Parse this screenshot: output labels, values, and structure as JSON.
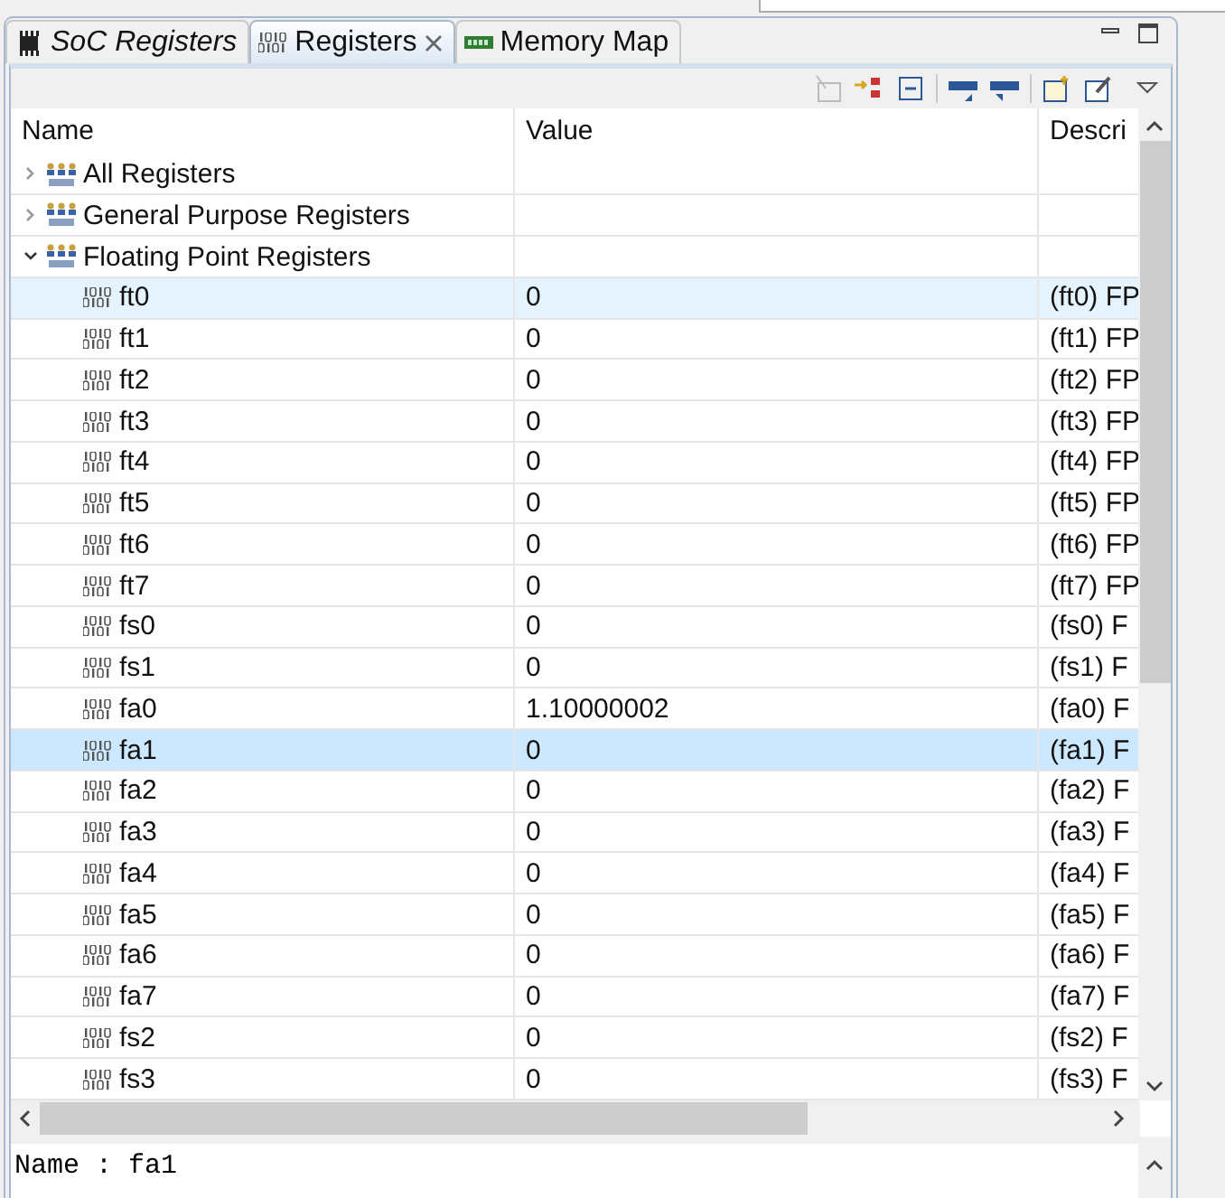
{
  "tabs": [
    {
      "label": "SoC Registers",
      "kind": "chip",
      "selected": false,
      "italic": true,
      "closable": false
    },
    {
      "label": "Registers",
      "kind": "binary",
      "selected": true,
      "italic": false,
      "closable": true
    },
    {
      "label": "Memory Map",
      "kind": "memory",
      "selected": false,
      "italic": false,
      "closable": false
    }
  ],
  "table": {
    "columns": [
      "Name",
      "Value",
      "Descri"
    ],
    "rows": [
      {
        "kind": "group",
        "name": "All Registers",
        "expanded": false,
        "selected": false,
        "hovered": false
      },
      {
        "kind": "group",
        "name": "General Purpose Registers",
        "expanded": false,
        "selected": false,
        "hovered": false
      },
      {
        "kind": "group",
        "name": "Floating Point Registers",
        "expanded": true,
        "selected": false,
        "hovered": false
      },
      {
        "kind": "register",
        "name": "ft0",
        "value": "0",
        "description": "(ft0) FP",
        "selected": false,
        "hovered": true
      },
      {
        "kind": "register",
        "name": "ft1",
        "value": "0",
        "description": "(ft1) FP",
        "selected": false,
        "hovered": false
      },
      {
        "kind": "register",
        "name": "ft2",
        "value": "0",
        "description": "(ft2) FP",
        "selected": false,
        "hovered": false
      },
      {
        "kind": "register",
        "name": "ft3",
        "value": "0",
        "description": "(ft3) FP",
        "selected": false,
        "hovered": false
      },
      {
        "kind": "register",
        "name": "ft4",
        "value": "0",
        "description": "(ft4) FP",
        "selected": false,
        "hovered": false
      },
      {
        "kind": "register",
        "name": "ft5",
        "value": "0",
        "description": "(ft5) FP",
        "selected": false,
        "hovered": false
      },
      {
        "kind": "register",
        "name": "ft6",
        "value": "0",
        "description": "(ft6) FP",
        "selected": false,
        "hovered": false
      },
      {
        "kind": "register",
        "name": "ft7",
        "value": "0",
        "description": "(ft7) FP",
        "selected": false,
        "hovered": false
      },
      {
        "kind": "register",
        "name": "fs0",
        "value": "0",
        "description": "(fs0) F",
        "selected": false,
        "hovered": false
      },
      {
        "kind": "register",
        "name": "fs1",
        "value": "0",
        "description": "(fs1) F",
        "selected": false,
        "hovered": false
      },
      {
        "kind": "register",
        "name": "fa0",
        "value": "1.10000002",
        "description": "(fa0) F",
        "selected": false,
        "hovered": false
      },
      {
        "kind": "register",
        "name": "fa1",
        "value": "0",
        "description": "(fa1) F",
        "selected": true,
        "hovered": false
      },
      {
        "kind": "register",
        "name": "fa2",
        "value": "0",
        "description": "(fa2) F",
        "selected": false,
        "hovered": false
      },
      {
        "kind": "register",
        "name": "fa3",
        "value": "0",
        "description": "(fa3) F",
        "selected": false,
        "hovered": false
      },
      {
        "kind": "register",
        "name": "fa4",
        "value": "0",
        "description": "(fa4) F",
        "selected": false,
        "hovered": false
      },
      {
        "kind": "register",
        "name": "fa5",
        "value": "0",
        "description": "(fa5) F",
        "selected": false,
        "hovered": false
      },
      {
        "kind": "register",
        "name": "fa6",
        "value": "0",
        "description": "(fa6) F",
        "selected": false,
        "hovered": false
      },
      {
        "kind": "register",
        "name": "fa7",
        "value": "0",
        "description": "(fa7) F",
        "selected": false,
        "hovered": false
      },
      {
        "kind": "register",
        "name": "fs2",
        "value": "0",
        "description": "(fs2) F",
        "selected": false,
        "hovered": false
      },
      {
        "kind": "register",
        "name": "fs3",
        "value": "0",
        "description": "(fs3) F",
        "selected": false,
        "hovered": false
      }
    ]
  },
  "detail": {
    "text": "Name : fa1"
  }
}
